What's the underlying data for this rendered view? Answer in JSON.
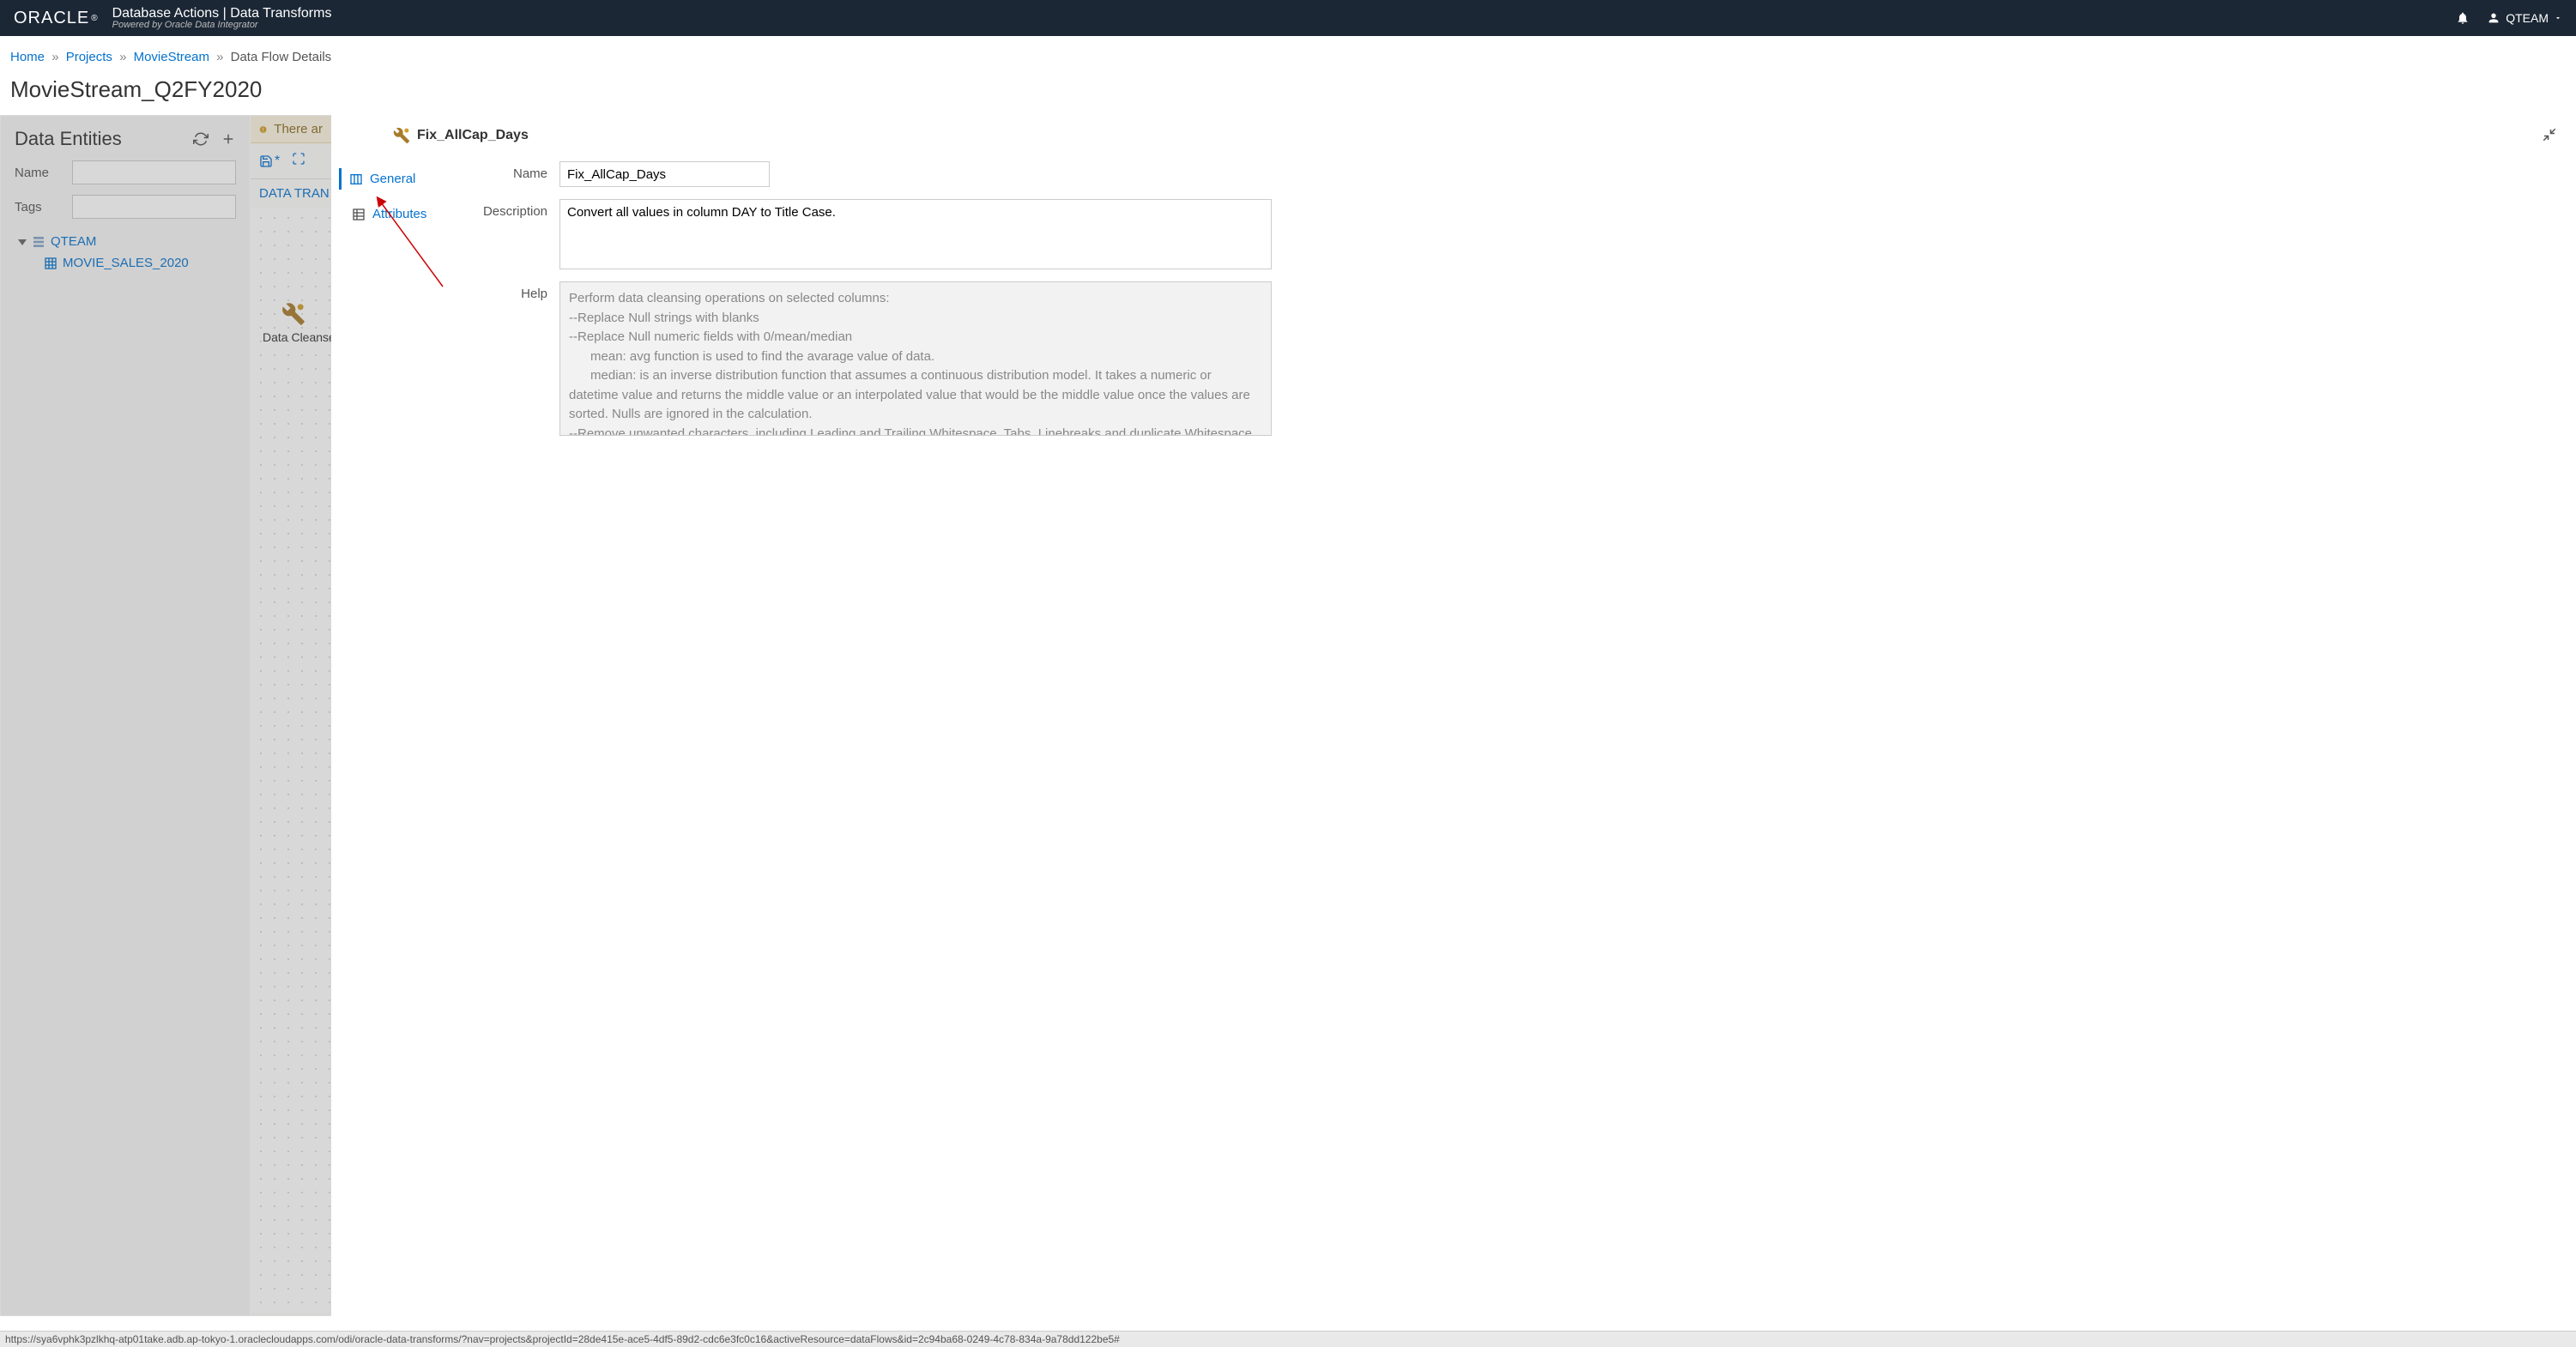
{
  "header": {
    "logo": "ORACLE",
    "app_title": "Database Actions | Data Transforms",
    "subtitle": "Powered by Oracle Data Integrator",
    "user": "QTEAM"
  },
  "breadcrumb": {
    "items": [
      "Home",
      "Projects",
      "MovieStream",
      "Data Flow Details"
    ]
  },
  "page_title": "MovieStream_Q2FY2020",
  "sidebar": {
    "title": "Data Entities",
    "name_label": "Name",
    "tags_label": "Tags",
    "tree": {
      "root": "QTEAM",
      "child": "MOVIE_SALES_2020"
    }
  },
  "canvas": {
    "warning": "There ar",
    "tab": "DATA TRAN",
    "component": "Data Cleanse"
  },
  "properties": {
    "title": "Fix_AllCap_Days",
    "tabs": {
      "general": "General",
      "attributes": "Attributes"
    },
    "form": {
      "name_label": "Name",
      "name_value": "Fix_AllCap_Days",
      "desc_label": "Description",
      "desc_value": "Convert all values in column DAY to Title Case.",
      "help_label": "Help",
      "help_text": "Perform data cleansing operations on selected columns:\n--Replace Null strings with blanks\n--Replace Null numeric fields with 0/mean/median\n      mean: avg function is used to find the avarage value of data.\n      median: is an inverse distribution function that assumes a continuous distribution model. It takes a numeric or datetime value and returns the middle value or an interpolated value that would be the middle value once the values are sorted. Nulls are ignored in the calculation.\n--Remove unwanted characters, including Leading and Trailing Whitespace, Tabs, Linebreaks and duplicate Whitespace,"
    }
  },
  "status_url": "https://sya6vphk3pzlkhq-atp01take.adb.ap-tokyo-1.oraclecloudapps.com/odi/oracle-data-transforms/?nav=projects&projectId=28de415e-ace5-4df5-89d2-cdc6e3fc0c16&activeResource=dataFlows&id=2c94ba68-0249-4c78-834a-9a78dd122be5#"
}
